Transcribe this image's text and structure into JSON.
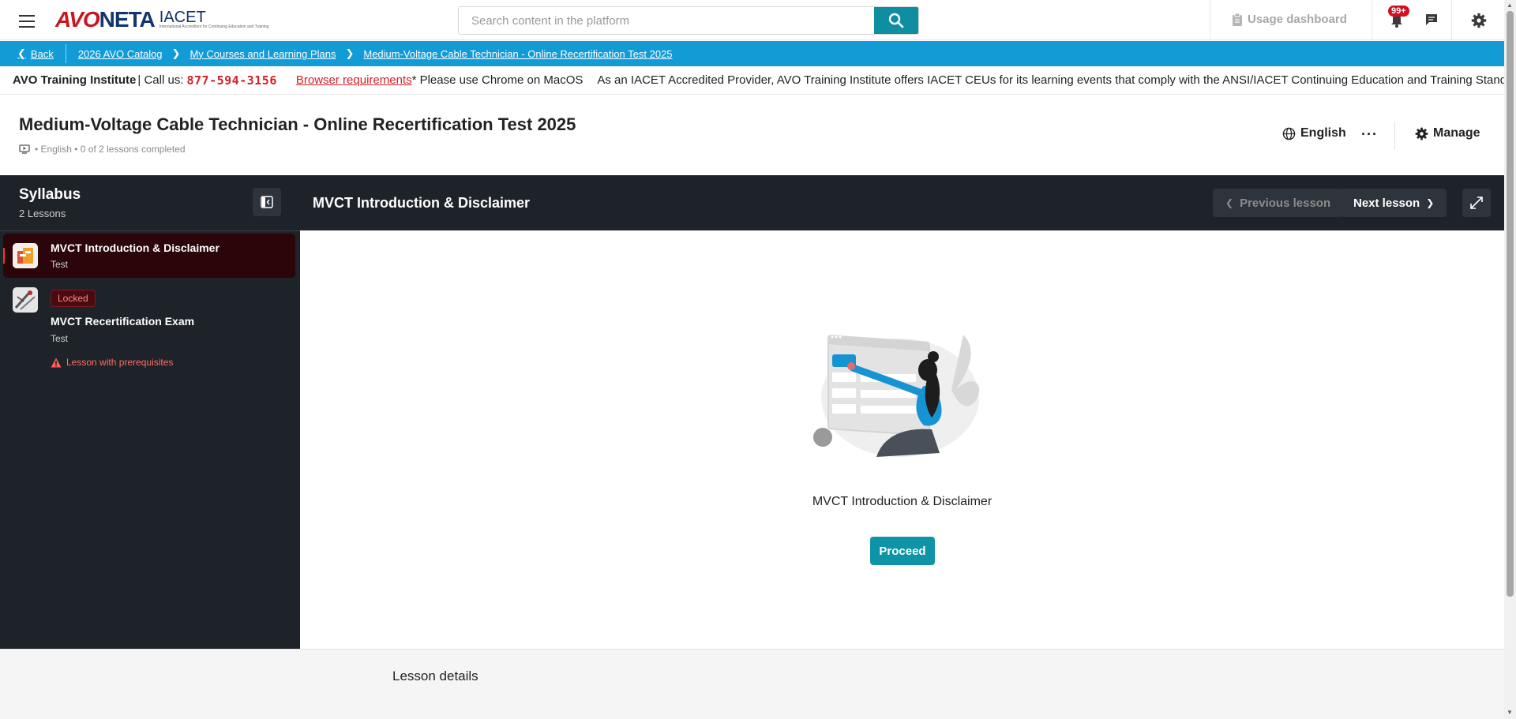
{
  "header": {
    "logo": {
      "avo": "AVO",
      "neta": "NETA",
      "iacet": "IACET",
      "iacet_sub": "International Accreditors for Continuing Education and Training"
    },
    "search": {
      "placeholder": "Search content in the platform"
    },
    "usage_dashboard_label": "Usage dashboard",
    "notification_count": "99+"
  },
  "breadcrumb": {
    "back_label": "Back",
    "items": [
      "2026 AVO Catalog",
      "My Courses and Learning Plans",
      "Medium-Voltage Cable Technician - Online Recertification Test 2025"
    ]
  },
  "banner": {
    "institute": "AVO Training Institute",
    "call_label": "| Call us:",
    "phone": "877-594-3156",
    "requirements_link": "Browser requirements",
    "requirements_note": "* Please use Chrome on MacOS",
    "iacet_note": "As an IACET Accredited Provider, AVO Training Institute offers IACET CEUs for its learning events that comply with the ANSI/IACET Continuing Education and Training Standard."
  },
  "course": {
    "title": "Medium-Voltage Cable Technician - Online Recertification Test 2025",
    "meta": "• English • 0 of 2 lessons completed",
    "language_label": "English",
    "more_label": "···",
    "manage_label": "Manage"
  },
  "syllabus": {
    "title": "Syllabus",
    "count": "2 Lessons",
    "lessons": [
      {
        "name": "MVCT Introduction & Disclaimer",
        "type": "Test",
        "active": true
      },
      {
        "name": "MVCT Recertification Exam",
        "type": "Test",
        "locked_label": "Locked",
        "prerequisite_label": "Lesson with prerequisites"
      }
    ]
  },
  "lesson": {
    "title": "MVCT Introduction & Disclaimer",
    "prev_label": "Previous lesson",
    "next_label": "Next lesson",
    "content_name": "MVCT Introduction & Disclaimer",
    "proceed_label": "Proceed"
  },
  "details": {
    "label": "Lesson details"
  },
  "colors": {
    "brand_teal": "#0f93a6",
    "breadcrumb_blue": "#129bd5",
    "sidebar_dark": "#1e2329",
    "alert_red": "#d32027"
  }
}
